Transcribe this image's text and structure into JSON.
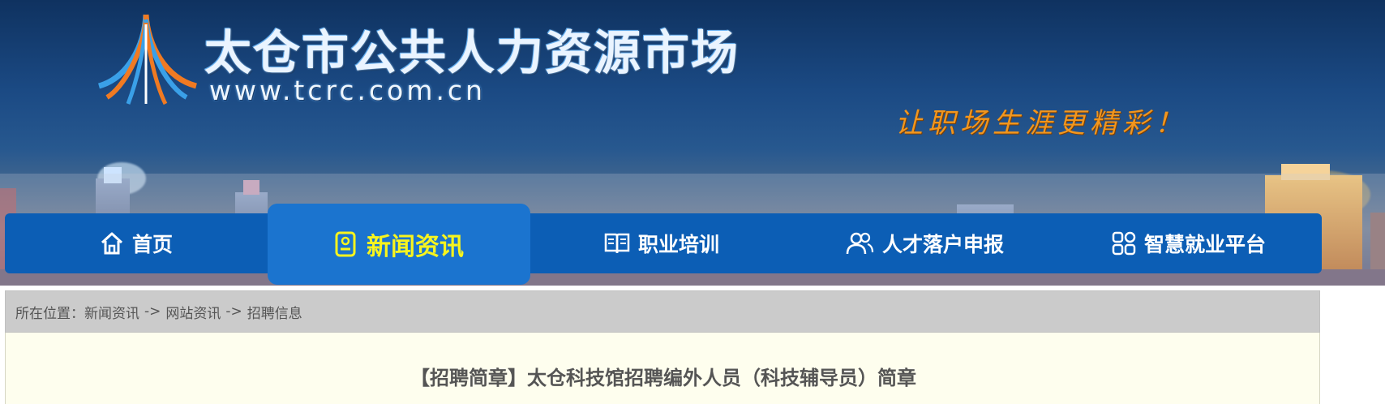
{
  "header": {
    "site_title": "太仓市公共人力资源市场",
    "site_url": "www.tcrc.com.cn",
    "slogan": "让职场生涯更精彩！"
  },
  "nav": {
    "items": [
      {
        "label": "首页",
        "icon": "home-icon"
      },
      {
        "label": "新闻资讯",
        "icon": "news-icon",
        "active": true
      },
      {
        "label": "职业培训",
        "icon": "book-icon"
      },
      {
        "label": "人才落户申报",
        "icon": "users-icon"
      },
      {
        "label": "智慧就业平台",
        "icon": "grid-icon"
      }
    ]
  },
  "breadcrumb": {
    "prefix": "所在位置：",
    "items": [
      "新闻资讯",
      "网站资讯",
      "招聘信息"
    ],
    "separator": "->"
  },
  "article": {
    "title": "【招聘简章】太仓科技馆招聘编外人员（科技辅导员）简章"
  },
  "colors": {
    "nav_bg": "#0c5eb5",
    "nav_active_bg": "#1b74cf",
    "nav_active_text": "#f7f41e",
    "slogan": "#f2961d",
    "breadcrumb_bg": "#cbcbcb",
    "content_bg": "#fefeee"
  }
}
